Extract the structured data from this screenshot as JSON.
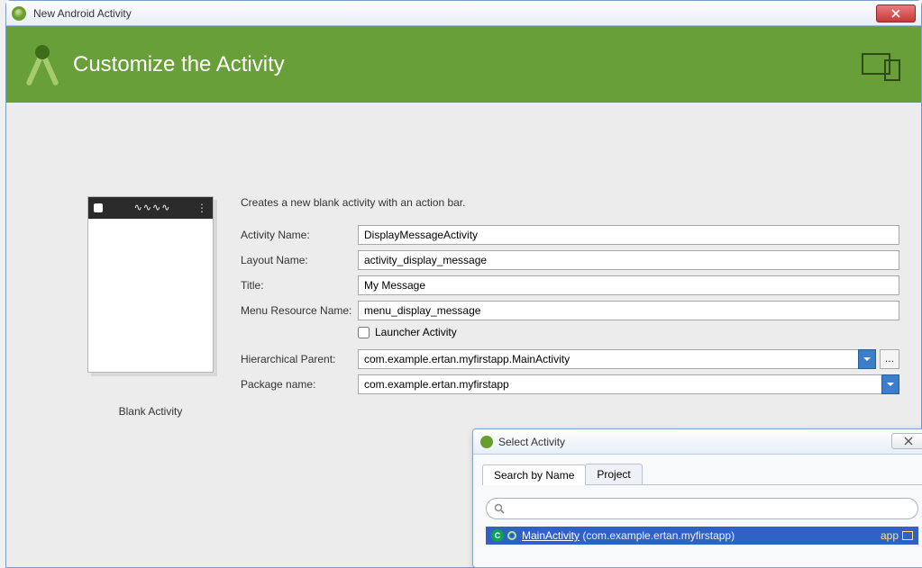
{
  "window": {
    "title": "New Android Activity"
  },
  "banner": {
    "heading": "Customize the Activity"
  },
  "preview": {
    "label": "Blank Activity"
  },
  "form": {
    "intro": "Creates a new blank activity with an action bar.",
    "labels": {
      "activity_name": "Activity Name:",
      "layout_name": "Layout Name:",
      "title": "Title:",
      "menu_resource": "Menu Resource Name:",
      "launcher": "Launcher Activity",
      "hierarchical_parent": "Hierarchical Parent:",
      "package_name": "Package name:"
    },
    "values": {
      "activity_name": "DisplayMessageActivity",
      "layout_name": "activity_display_message",
      "title": "My Message",
      "menu_resource": "menu_display_message",
      "hierarchical_parent": "com.example.ertan.myfirstapp.MainActivity",
      "package_name": "com.example.ertan.myfirstapp"
    }
  },
  "popup": {
    "title": "Select Activity",
    "tabs": {
      "byname": "Search by Name",
      "project": "Project"
    },
    "search_placeholder": "",
    "result": {
      "class": "MainActivity",
      "package": "(com.example.ertan.myfirstapp)",
      "module": "app"
    }
  }
}
